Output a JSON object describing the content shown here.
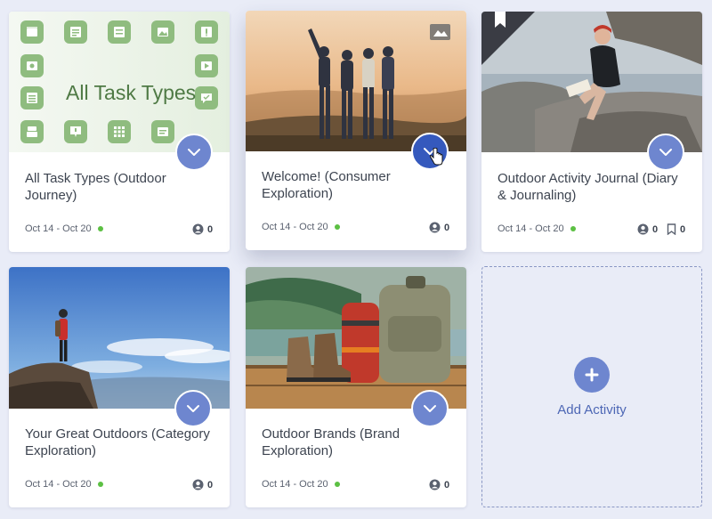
{
  "cards": [
    {
      "title": "All Task Types (Outdoor Journey)",
      "date": "Oct 14 - Oct 20",
      "participants": "0",
      "thumbnail_text": "All Task Types",
      "thumbnail": "task-type-icon-grid"
    },
    {
      "title": "Welcome! (Consumer Exploration)",
      "date": "Oct 14 - Oct 20",
      "participants": "0",
      "thumbnail": "friends-hugging-at-sunset-photo"
    },
    {
      "title": "Outdoor Activity Journal (Diary & Journaling)",
      "date": "Oct 14 - Oct 20",
      "participants": "0",
      "bookmarks": "0",
      "thumbnail": "man-writing-journal-on-rocks-photo"
    },
    {
      "title": "Your Great Outdoors (Category Exploration)",
      "date": "Oct 14 - Oct 20",
      "participants": "0",
      "thumbnail": "hiker-on-cliff-photo"
    },
    {
      "title": "Outdoor Brands (Brand Exploration)",
      "date": "Oct 14 - Oct 20",
      "participants": "0",
      "thumbnail": "hiking-boots-and-backpack-photo"
    }
  ],
  "add_activity": {
    "label": "Add Activity"
  },
  "colors": {
    "background": "#e9ecf7",
    "accent": "#6e86cf",
    "accent_active": "#3559bd",
    "status_dot": "#5cc043",
    "task_tile": "#8fbc7f"
  }
}
